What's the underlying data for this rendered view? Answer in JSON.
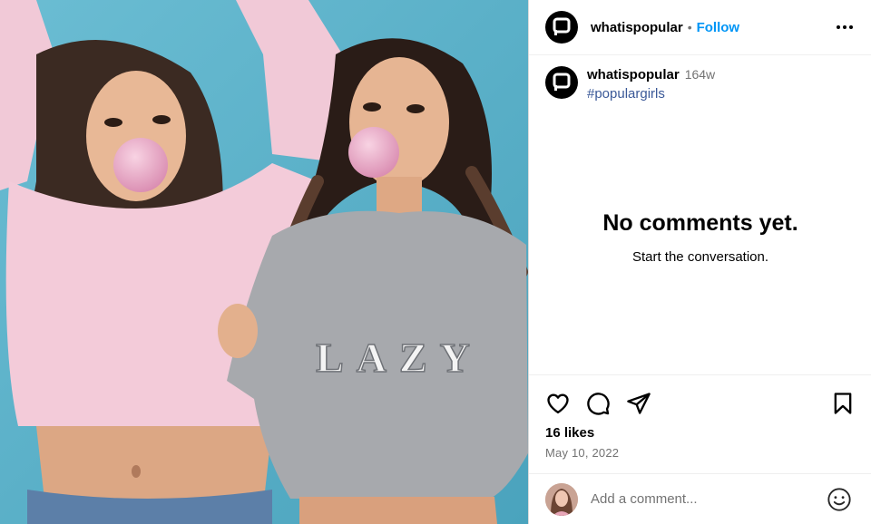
{
  "post": {
    "image_alt": "Two girls blowing bubble gum, one wearing a pink sweatshirt and one wearing a grey LAZY sweatshirt",
    "sweatshirt_text": "LAZY"
  },
  "header": {
    "username": "whatispopular",
    "separator": "•",
    "follow_label": "Follow",
    "more_icon": "more-horizontal-icon"
  },
  "caption": {
    "username": "whatispopular",
    "age": "164w",
    "hashtag": "#populargirls"
  },
  "comments": {
    "empty_title": "No comments yet.",
    "empty_subtitle": "Start the conversation."
  },
  "actions": {
    "like_icon": "heart-icon",
    "comment_icon": "comment-icon",
    "share_icon": "share-icon",
    "save_icon": "bookmark-icon"
  },
  "stats": {
    "likes": "16 likes",
    "date": "May 10, 2022"
  },
  "comment_input": {
    "placeholder": "Add a comment...",
    "emoji_icon": "emoji-icon"
  },
  "colors": {
    "accent": "#0095f6",
    "hashtag": "#3b5998",
    "secondary_text": "#737373",
    "border": "#efefef",
    "photo_bg": "#5fb3c9"
  }
}
